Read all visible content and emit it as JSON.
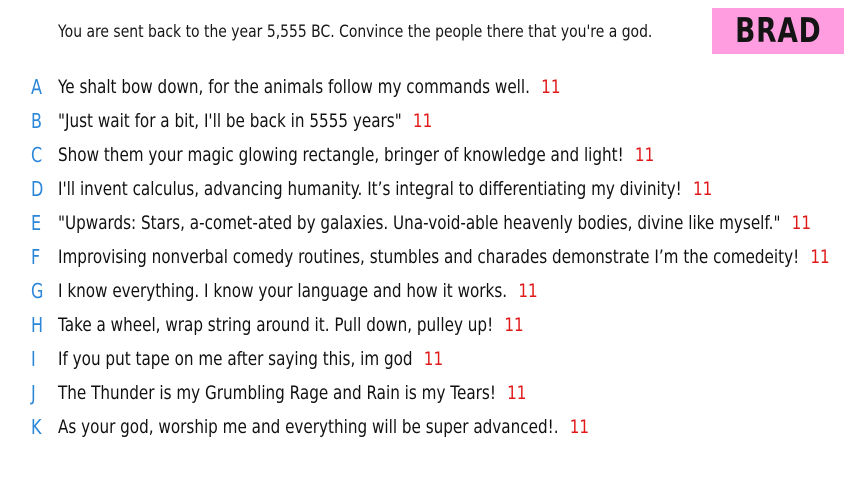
{
  "prompt": "You are sent back to the year 5,555 BC. Convince the people there that you're a god.",
  "player": {
    "name": "BRAD",
    "badge_color": "#ff9de0"
  },
  "colors": {
    "letter": "#2b86d8",
    "score": "#e01818",
    "text": "#111111"
  },
  "answers": [
    {
      "letter": "A",
      "text": "Ye shalt bow down, for the animals follow my commands well.",
      "score": "11"
    },
    {
      "letter": "B",
      "text": "\"Just wait for a bit, I'll be back in 5555 years\"",
      "score": "11"
    },
    {
      "letter": "C",
      "text": "Show them your magic glowing rectangle, bringer of knowledge and light!",
      "score": "11"
    },
    {
      "letter": "D",
      "text": "I'll invent calculus, advancing humanity. It’s integral to differentiating my divinity!",
      "score": "11"
    },
    {
      "letter": "E",
      "text": "\"Upwards: Stars, a-comet-ated by galaxies. Una-void-able heavenly bodies, divine like myself.\"",
      "score": "11"
    },
    {
      "letter": "F",
      "text": "Improvising nonverbal comedy routines, stumbles and charades demonstrate I’m the comedeity!",
      "score": "11"
    },
    {
      "letter": "G",
      "text": "I know everything. I know your language and how it works.",
      "score": "11"
    },
    {
      "letter": "H",
      "text": "Take a wheel, wrap string around it. Pull down, pulley up!",
      "score": "11"
    },
    {
      "letter": "I",
      "text": "If you put tape on me after saying this, im god",
      "score": "11"
    },
    {
      "letter": "J",
      "text": "The Thunder is my Grumbling Rage and Rain is my Tears!",
      "score": "11"
    },
    {
      "letter": "K",
      "text": "As your god, worship me and everything will be super advanced!.",
      "score": "11"
    }
  ]
}
